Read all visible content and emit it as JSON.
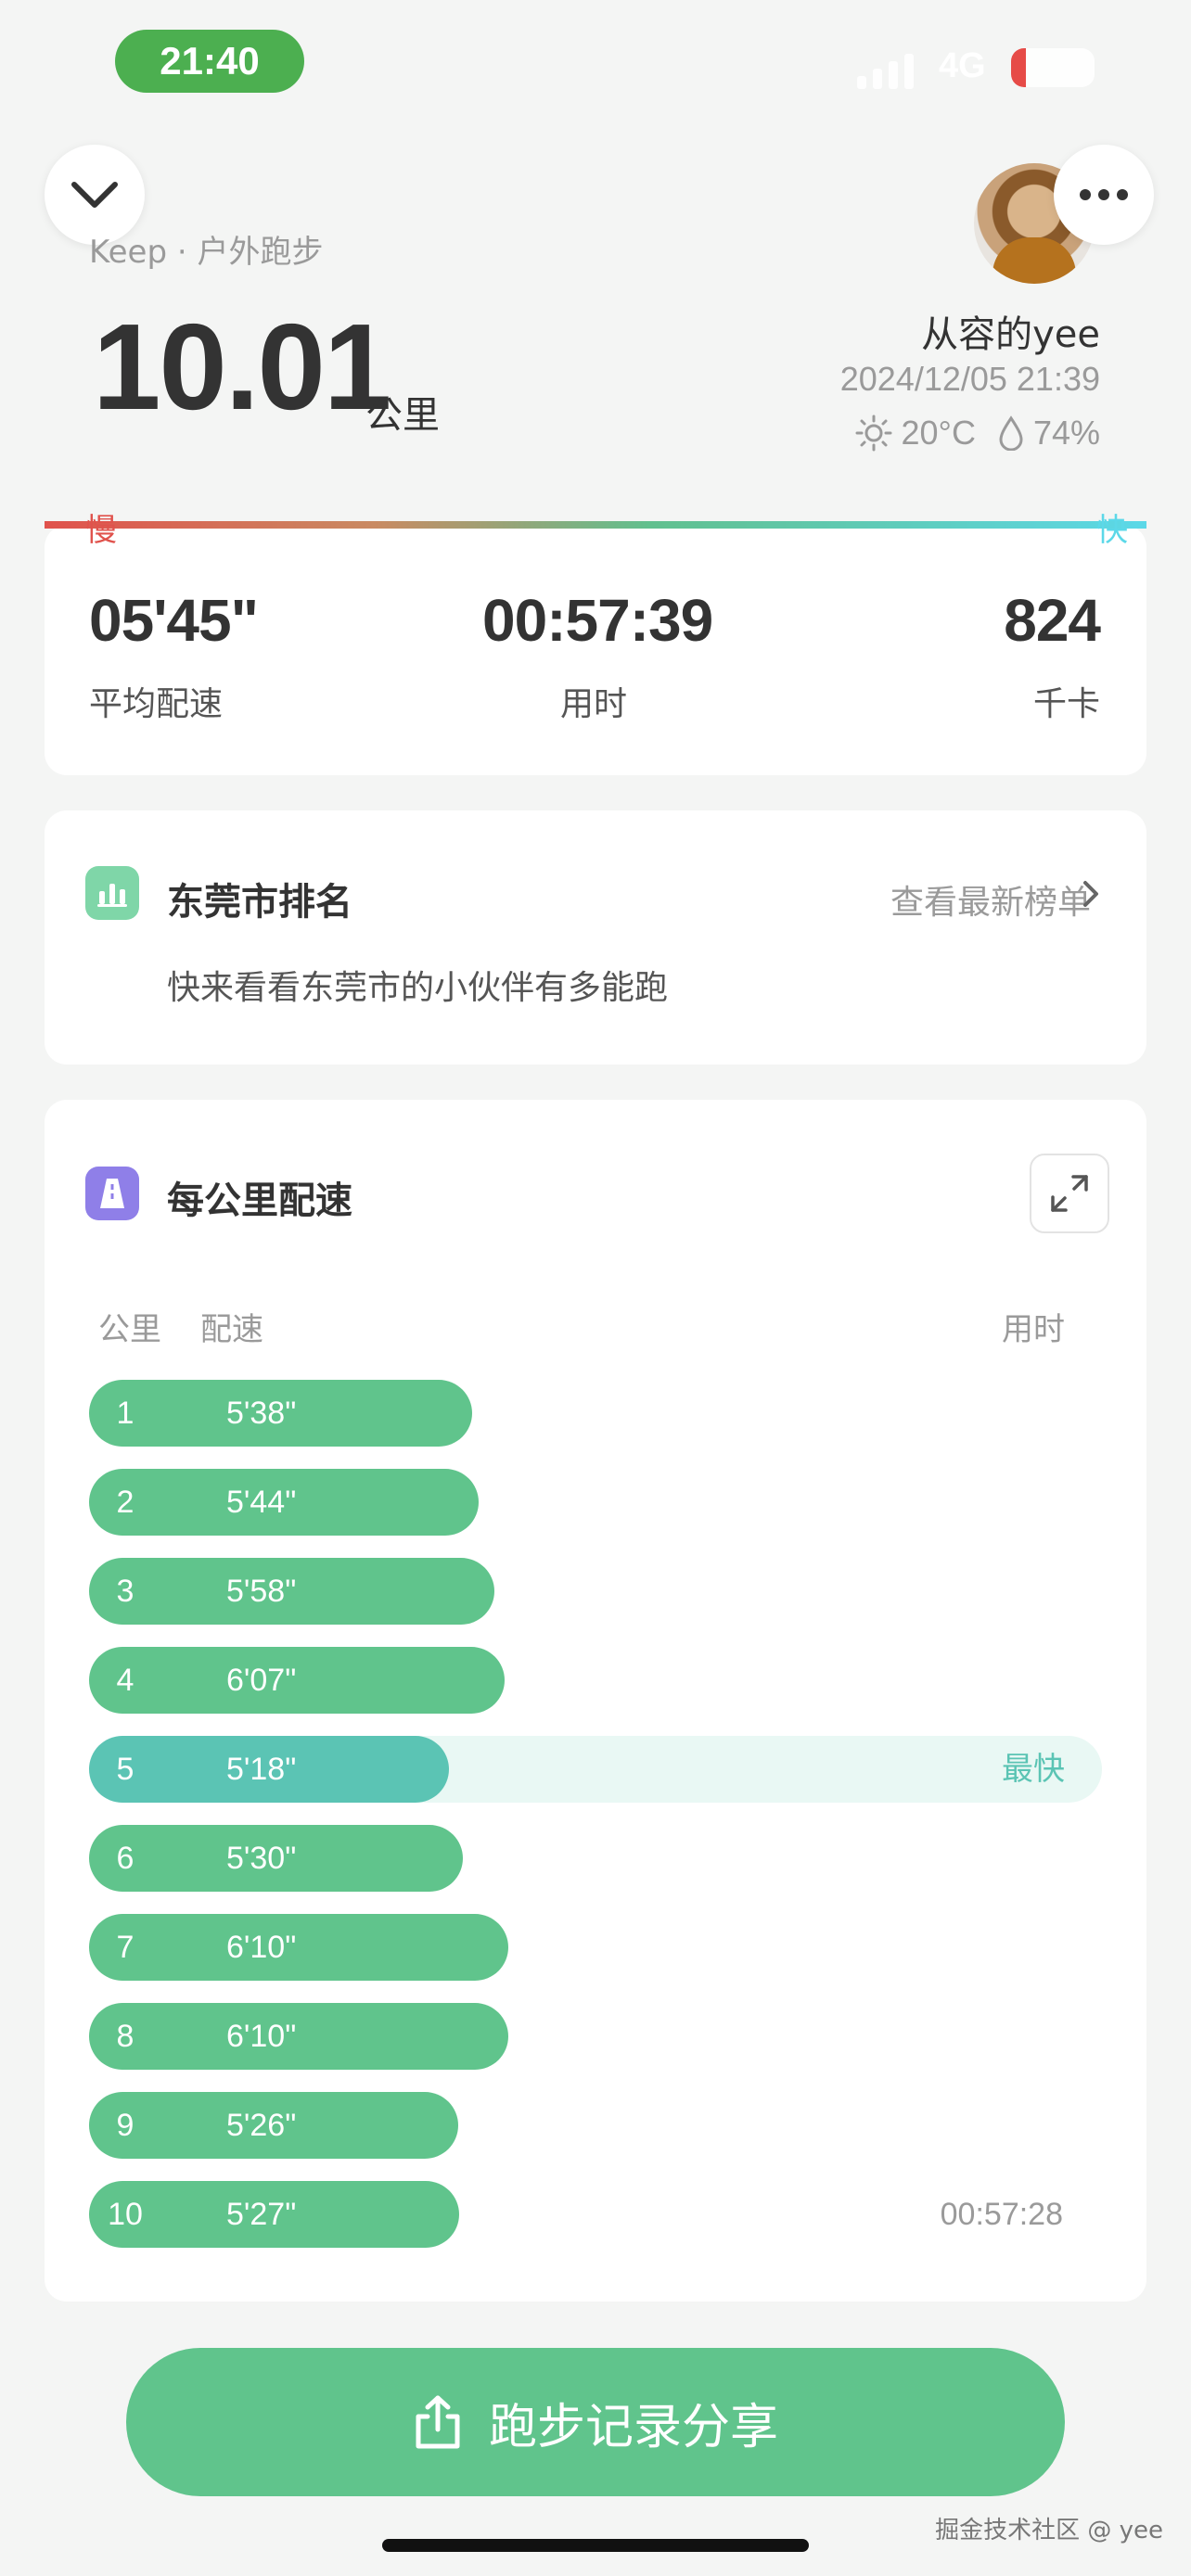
{
  "status_bar": {
    "time": "21:40",
    "network": "4G"
  },
  "header": {
    "brand_line": "Keep · 户外跑步",
    "distance": "10.01",
    "distance_unit": "公里",
    "username": "从容的yee",
    "datetime": "2024/12/05 21:39",
    "temperature": "20°C",
    "humidity": "74%"
  },
  "pace_scale": {
    "slow": "慢",
    "fast": "快",
    "colors": [
      "#e0524c",
      "#61c08e",
      "#5cd8e8"
    ]
  },
  "stats": [
    {
      "value": "05'45\"",
      "label": "平均配速"
    },
    {
      "value": "00:57:39",
      "label": "用时"
    },
    {
      "value": "824",
      "label": "千卡"
    }
  ],
  "ranking": {
    "title": "东莞市排名",
    "link": "查看最新榜单",
    "subtitle": "快来看看东莞市的小伙伴有多能跑"
  },
  "splits": {
    "title": "每公里配速",
    "col_km": "公里",
    "col_pace": "配速",
    "col_time": "用时",
    "fastest_label": "最快",
    "total_time": "00:57:28",
    "rows": [
      {
        "km": "1",
        "pace": "5'38\"",
        "seconds": 338
      },
      {
        "km": "2",
        "pace": "5'44\"",
        "seconds": 344
      },
      {
        "km": "3",
        "pace": "5'58\"",
        "seconds": 358
      },
      {
        "km": "4",
        "pace": "6'07\"",
        "seconds": 367
      },
      {
        "km": "5",
        "pace": "5'18\"",
        "seconds": 318,
        "fastest": true
      },
      {
        "km": "6",
        "pace": "5'30\"",
        "seconds": 330
      },
      {
        "km": "7",
        "pace": "6'10\"",
        "seconds": 370
      },
      {
        "km": "8",
        "pace": "6'10\"",
        "seconds": 370
      },
      {
        "km": "9",
        "pace": "5'26\"",
        "seconds": 326
      },
      {
        "km": "10",
        "pace": "5'27\"",
        "seconds": 327
      }
    ]
  },
  "share_button": "跑步记录分享",
  "watermark": "掘金技术社区 @ yee",
  "colors": {
    "accent": "#60c48c",
    "fastest": "#5bc4b4",
    "status_green": "#4caf50"
  }
}
